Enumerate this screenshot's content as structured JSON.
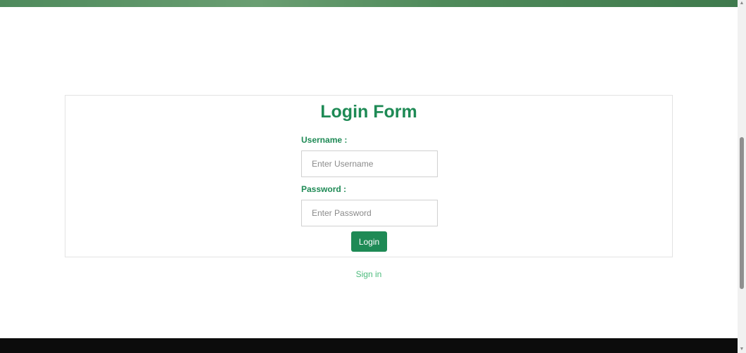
{
  "login_form": {
    "title": "Login Form",
    "username_label": "Username :",
    "username_placeholder": "Enter Username",
    "username_value": "",
    "password_label": "Password :",
    "password_placeholder": "Enter Password",
    "password_value": "",
    "login_button_label": "Login"
  },
  "links": {
    "sign_in": "Sign in"
  },
  "icons": {
    "scroll_up": "chevron-up-icon",
    "scroll_down": "chevron-down-icon"
  },
  "colors": {
    "accent": "#1e8a55",
    "link": "#4cbb7c",
    "footer": "#0c0c0c"
  }
}
